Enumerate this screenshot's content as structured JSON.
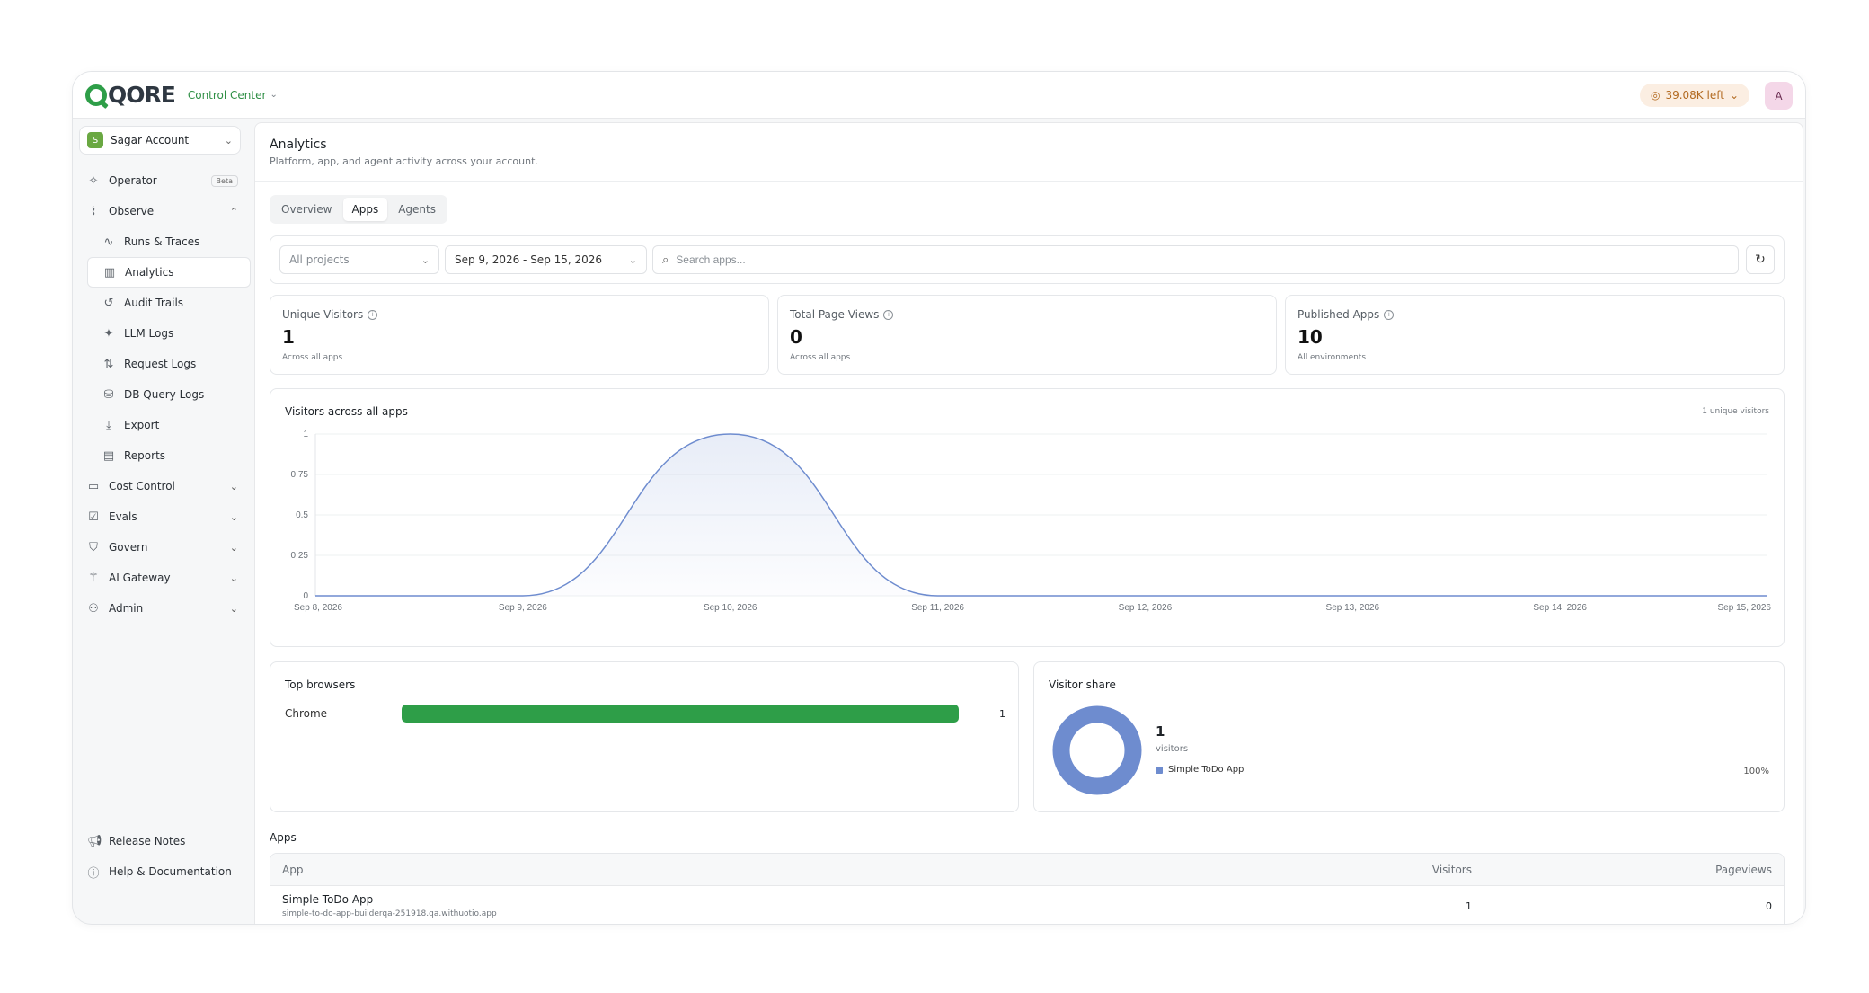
{
  "topbar": {
    "brand": "QORE",
    "workspace": "Control Center",
    "credits": "39.08K left",
    "avatar_initial": "A"
  },
  "sidebar": {
    "account": {
      "initial": "S",
      "name": "Sagar Account"
    },
    "items": [
      {
        "label": "Operator",
        "icon": "sparkle-icon",
        "badge": "Beta"
      },
      {
        "label": "Observe",
        "icon": "chart-icon",
        "expanded": true,
        "children": [
          {
            "label": "Runs & Traces",
            "icon": "activity-icon"
          },
          {
            "label": "Analytics",
            "icon": "bar-chart-icon",
            "active": true
          },
          {
            "label": "Audit Trails",
            "icon": "history-icon"
          },
          {
            "label": "LLM Logs",
            "icon": "sparkle-icon"
          },
          {
            "label": "Request Logs",
            "icon": "arrows-updown-icon"
          },
          {
            "label": "DB Query Logs",
            "icon": "database-icon"
          },
          {
            "label": "Export",
            "icon": "download-icon"
          },
          {
            "label": "Reports",
            "icon": "file-icon"
          }
        ]
      },
      {
        "label": "Cost Control",
        "icon": "wallet-icon"
      },
      {
        "label": "Evals",
        "icon": "clipboard-check-icon"
      },
      {
        "label": "Govern",
        "icon": "shield-icon"
      },
      {
        "label": "AI Gateway",
        "icon": "wand-icon"
      },
      {
        "label": "Admin",
        "icon": "user-cog-icon"
      }
    ],
    "footer": [
      {
        "label": "Release Notes",
        "icon": "megaphone-icon"
      },
      {
        "label": "Help & Documentation",
        "icon": "help-icon"
      }
    ]
  },
  "page": {
    "title": "Analytics",
    "subtitle": "Platform, app, and agent activity across your account.",
    "tabs": [
      "Overview",
      "Apps",
      "Agents"
    ],
    "active_tab": "Apps"
  },
  "filters": {
    "project": "All projects",
    "date_range": "Sep 9, 2026 - Sep 15, 2026",
    "search_placeholder": "Search apps..."
  },
  "stats": [
    {
      "label": "Unique Visitors",
      "value": "1",
      "note": "Across all apps"
    },
    {
      "label": "Total Page Views",
      "value": "0",
      "note": "Across all apps"
    },
    {
      "label": "Published Apps",
      "value": "10",
      "note": "All environments"
    }
  ],
  "visitors_chart": {
    "title": "Visitors across all apps",
    "note": "1 unique visitors"
  },
  "chart_data": {
    "type": "area",
    "title": "Visitors across all apps",
    "x": [
      "Sep 8, 2026",
      "Sep 9, 2026",
      "Sep 10, 2026",
      "Sep 11, 2026",
      "Sep 12, 2026",
      "Sep 13, 2026",
      "Sep 14, 2026",
      "Sep 15, 2026"
    ],
    "series": [
      {
        "values": [
          0,
          0,
          1,
          0,
          0,
          0,
          0,
          0
        ]
      }
    ],
    "yticks": [
      "0",
      "0.25",
      "0.5",
      "0.75",
      "1"
    ],
    "ylim": [
      0,
      1
    ],
    "grid": true,
    "color": "#6e8ccf"
  },
  "browsers": {
    "title": "Top browsers",
    "rows": [
      {
        "name": "Chrome",
        "count": "1",
        "share": 1.0
      }
    ],
    "bar_color": "#2e9e48"
  },
  "visitor_share": {
    "title": "Visitor share",
    "total": "1",
    "unit": "visitors",
    "legend": [
      {
        "name": "Simple ToDo App",
        "percent": "100%",
        "color": "#6e8ccf"
      }
    ]
  },
  "apps": {
    "title": "Apps",
    "columns": [
      "App",
      "Visitors",
      "Pageviews"
    ],
    "rows": [
      {
        "name": "Simple ToDo App",
        "url": "simple-to-do-app-builderqa-251918.qa.withuotio.app",
        "visitors": "1",
        "pageviews": "0"
      }
    ]
  }
}
